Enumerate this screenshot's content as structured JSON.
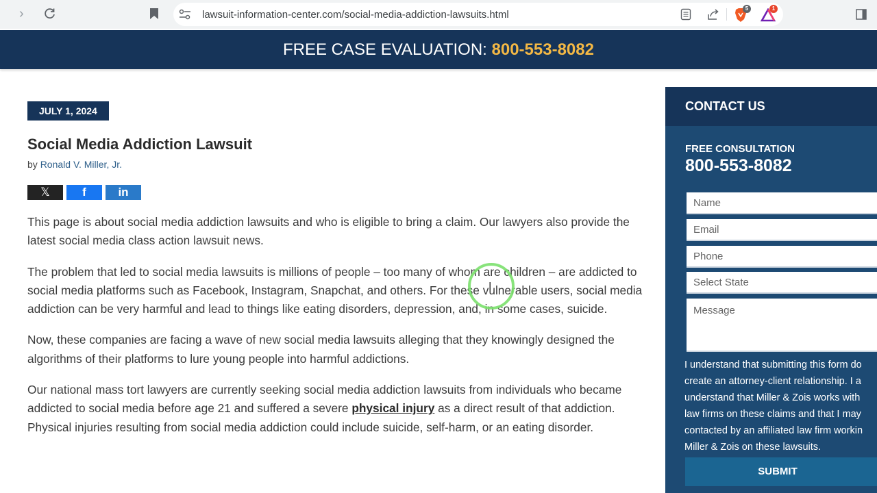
{
  "browser": {
    "url": "lawsuit-information-center.com/social-media-addiction-lawsuits.html",
    "brave_shields_count": "5",
    "rewards_count": "1",
    "icons": {
      "forward": "chevron-right-icon",
      "reload": "reload-icon",
      "bookmark": "bookmark-icon",
      "site_info": "tune-icon",
      "reader": "reader-mode-icon",
      "share": "share-icon",
      "brave": "brave-shields-icon",
      "rewards": "brave-rewards-icon",
      "sidebar": "sidebar-toggle-icon"
    }
  },
  "banner": {
    "label": "FREE CASE EVALUATION: ",
    "phone": "800-553-8082",
    "bg_color": "#163459",
    "phone_color": "#f3b845"
  },
  "article": {
    "date": "JULY 1, 2024",
    "title": "Social Media Addiction Lawsuit",
    "byline_prefix": "by ",
    "author": "Ronald V. Miller, Jr.",
    "share": {
      "x": "𝕏",
      "facebook": "f",
      "linkedin": "in"
    },
    "paragraphs": [
      "This page is about social media addiction lawsuits and who is eligible to bring a claim. Our lawyers also provide the latest social media class action lawsuit news.",
      "The problem that led to social media lawsuits is millions of people – too many of whom are children – are addicted to social media platforms such as Facebook, Instagram, Snapchat, and others. For these vulnerable users, social media addiction can be very harmful and lead to things like eating disorders, depression, and, in some cases, suicide.",
      "Now, these companies are facing a wave of new social media lawsuits alleging that they knowingly designed the algorithms of their platforms to lure young people into harmful addictions."
    ],
    "p4": {
      "before": "Our national mass tort lawyers are currently seeking social media addiction lawsuits from individuals who became addicted to social media before age 21 and suffered a severe ",
      "link": "physical injury",
      "after": " as a direct result of that addiction. Physical injuries resulting from social media addiction could include suicide, self-harm, or an eating disorder."
    }
  },
  "sidebar": {
    "heading": "CONTACT US",
    "consult_label": "FREE CONSULTATION",
    "consult_phone": "800-553-8082",
    "form": {
      "name_placeholder": "Name",
      "email_placeholder": "Email",
      "phone_placeholder": "Phone",
      "state_selected": "Select State",
      "message_placeholder": "Message"
    },
    "disclaimer_lines": [
      "I understand that submitting this form do",
      "create an attorney-client relationship. I a",
      "understand that Miller & Zois works with",
      "law firms on these claims and that I may",
      "contacted by an affiliated law firm workin",
      "Miller & Zois on these lawsuits."
    ],
    "submit_label": "SUBMIT"
  }
}
